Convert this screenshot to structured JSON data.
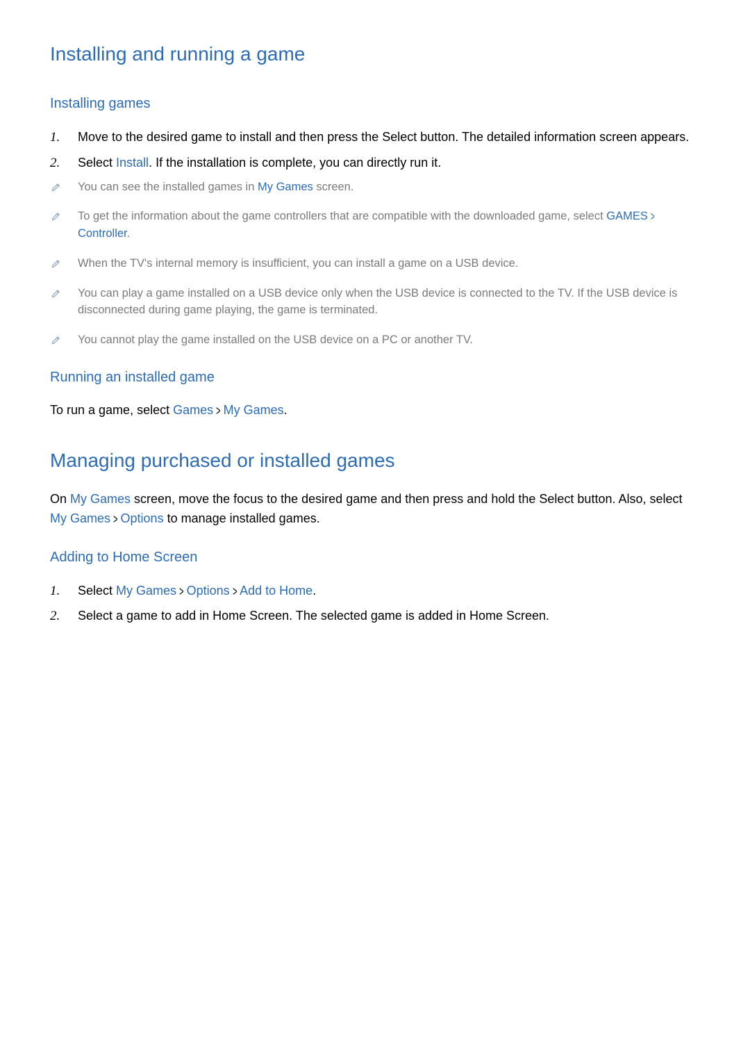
{
  "s1": {
    "title": "Installing and running a game",
    "h_installing": "Installing games",
    "step1": "Move to the desired game to install and then press the Select button. The detailed information screen appears.",
    "step2_a": "Select ",
    "step2_install": "Install",
    "step2_b": ". If the installation is complete, you can directly run it.",
    "n1_a": "You can see the installed games in ",
    "n1_mg": "My Games",
    "n1_b": " screen.",
    "n2_a": "To get the information about the game controllers that are compatible with the downloaded game, select ",
    "n2_games": "GAMES",
    "n2_ctrl": "Controller",
    "n2_b": ".",
    "n3": "When the TV's internal memory is insufficient, you can install a game on a USB device.",
    "n4": "You can play a game installed on a USB device only when the USB device is connected to the TV. If the USB device is disconnected during game playing, the game is terminated.",
    "n5": "You cannot play the game installed on the USB device on a PC or another TV.",
    "h_running": "Running an installed game",
    "run_a": "To run a game, select ",
    "run_games": "Games",
    "run_mg": "My Games",
    "run_b": "."
  },
  "s2": {
    "title": "Managing purchased or installed games",
    "intro_a": "On ",
    "intro_mg": "My Games",
    "intro_b": " screen, move the focus to the desired game and then press and hold the Select button. Also, select ",
    "intro_mg2": "My Games",
    "intro_opt": "Options",
    "intro_c": " to manage installed games.",
    "h_add": "Adding to Home Screen",
    "step1_a": "Select ",
    "step1_mg": "My Games",
    "step1_opt": "Options",
    "step1_add": "Add to Home",
    "step1_b": ".",
    "step2": "Select a game to add in Home Screen. The selected game is added in Home Screen."
  },
  "nums": {
    "one": "1.",
    "two": "2."
  },
  "chev": ">"
}
